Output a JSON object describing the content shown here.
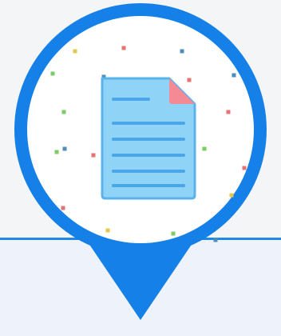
{
  "colors": {
    "background_top": "#f4f5f6",
    "background_bottom": "#eef2fb",
    "divider": "#1e88e5",
    "pin": "#1580e8",
    "pin_inner": "#ffffff",
    "doc_fill": "#8fd3f7",
    "doc_stroke": "#5bb3ea",
    "doc_lines": "#4aa6e6",
    "doc_corner": "#f48a93"
  },
  "icons": {
    "pin": "map-pin-icon",
    "document": "document-icon"
  },
  "confetti": [
    {
      "color": "#e57373"
    },
    {
      "color": "#4d8fb8"
    },
    {
      "color": "#e6c84d"
    },
    {
      "color": "#7ccc66"
    },
    {
      "color": "#e57373"
    },
    {
      "color": "#4d8fb8"
    },
    {
      "color": "#7ccc66"
    },
    {
      "color": "#4d8fb8"
    },
    {
      "color": "#e57373"
    },
    {
      "color": "#4d8fb8"
    },
    {
      "color": "#7ccc66"
    },
    {
      "color": "#e57373"
    },
    {
      "color": "#e57373"
    },
    {
      "color": "#7ccc66"
    },
    {
      "color": "#e6c84d"
    },
    {
      "color": "#e57373"
    },
    {
      "color": "#e6c84d"
    },
    {
      "color": "#7ccc66"
    },
    {
      "color": "#4d8fb8"
    }
  ]
}
